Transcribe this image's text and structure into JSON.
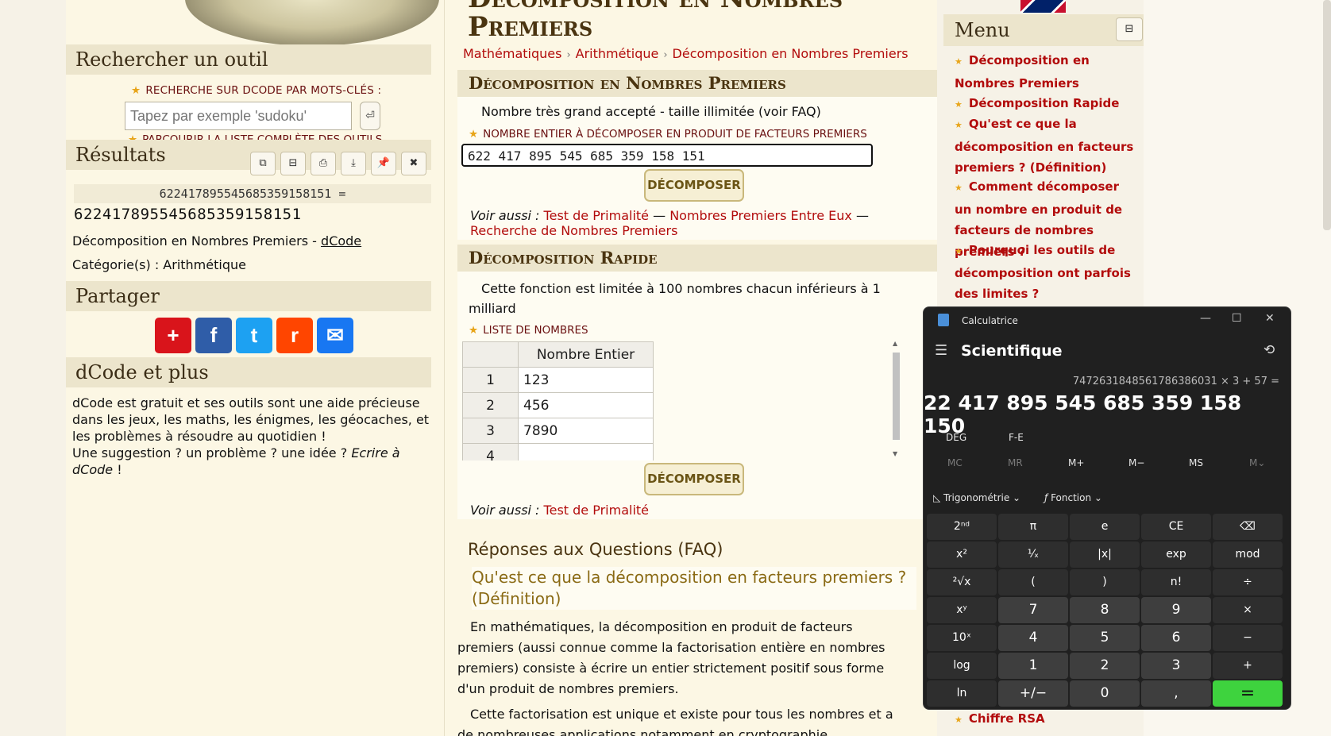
{
  "left": {
    "search_title": "Rechercher un outil",
    "search_label": "RECHERCHE SUR DCODE PAR MOTS-CLÉS :",
    "search_placeholder": "Tapez par exemple 'sudoku'",
    "browse_prefix": "PARCOURIR LA ",
    "browse_link": "LISTE COMPLÈTE DES OUTILS",
    "results_title": "Résultats",
    "result_expr": "62241789554568535915815​1 =",
    "result_value": "62241789554568535915815​1",
    "result_source_prefix": "Décomposition en Nombres Premiers - ",
    "result_source_link": "dCode",
    "result_category": "Catégorie(s) : Arithmétique",
    "share_title": "Partager",
    "more_title": "dCode et plus",
    "about_text": "dCode est gratuit et ses outils sont une aide précieuse dans les jeux, les maths, les énigmes, les géocaches, et les problèmes à résoudre au quotidien !",
    "about_line2": "Une suggestion ? un problème ? une idée ? ",
    "about_link": "Ecrire à dCode",
    "about_end": " !"
  },
  "main": {
    "title_line1": "Décomposition en Nombres",
    "title_line2": "Premiers",
    "crumbs": [
      "Mathématiques",
      "Arithmétique",
      "Décomposition en Nombres Premiers"
    ],
    "panel1_title": "Décomposition en Nombres Premiers",
    "panel1_note": "Nombre très grand accepté - taille illimitée (voir FAQ)",
    "panel1_label": "NOMBRE ENTIER À DÉCOMPOSER EN PRODUIT DE FACTEURS PREMIERS",
    "panel1_value": "622 417 895 545 685 359 158 151",
    "decompose": "DÉCOMPOSER",
    "voir_aussi": "Voir aussi :",
    "see_also1": [
      "Test de Primalité",
      "Nombres Premiers Entre Eux",
      "Recherche de Nombres Premiers"
    ],
    "panel2_title": "Décomposition Rapide",
    "panel2_note": "Cette fonction est limitée à 100 nombres chacun inférieurs à 1 milliard",
    "panel2_label": "LISTE DE NOMBRES",
    "table_header": "Nombre Entier",
    "table_rows": [
      {
        "idx": "1",
        "val": "123"
      },
      {
        "idx": "2",
        "val": "456"
      },
      {
        "idx": "3",
        "val": "7890"
      },
      {
        "idx": "4",
        "val": ""
      }
    ],
    "see_also2": "Test de Primalité",
    "faq_title": "Réponses aux Questions (FAQ)",
    "faq_q1": "Qu'est ce que la décomposition en facteurs premiers ? (Définition)",
    "faq_p1": "En mathématiques, la décomposition en produit de facteurs premiers (aussi connue comme la factorisation entière en nombres premiers) consiste à écrire un entier strictement positif sous forme d'un produit de nombres premiers.",
    "faq_p2": "Cette factorisation est unique et existe pour tous les nombres et a de nombreuses applications notamment en cryptographie."
  },
  "menu": {
    "title": "Menu",
    "items": [
      "Décomposition en Nombres Premiers",
      "Décomposition Rapide",
      "Qu'est ce que la décomposition en facteurs premiers ? (Définition)",
      "Comment décomposer un nombre en produit de facteurs de nombres premiers ?",
      "Pourquoi les outils de décomposition ont parfois des limites ?",
      "Chiffre RSA"
    ]
  },
  "calc": {
    "title": "Calculatrice",
    "mode": "Scientifique",
    "expression": "74726318485617863860​31 × 3 + 57 =",
    "display": "22 417 895 545 685 359 158 150",
    "deg": "DEG",
    "fe": "F-E",
    "memory": [
      "MC",
      "MR",
      "M+",
      "M−",
      "MS",
      "M⌄"
    ],
    "trig": "Trigonométrie",
    "func": "Fonction",
    "keys": [
      "2ⁿᵈ",
      "π",
      "e",
      "CE",
      "⌫",
      "x²",
      "¹⁄ₓ",
      "|x|",
      "exp",
      "mod",
      "²√x",
      "(",
      ")",
      "n!",
      "÷",
      "xʸ",
      "7",
      "8",
      "9",
      "×",
      "10ˣ",
      "4",
      "5",
      "6",
      "−",
      "log",
      "1",
      "2",
      "3",
      "+",
      "ln",
      "+/−",
      "0",
      ",",
      "="
    ]
  },
  "colors": {
    "accent_red": "#b20c0c",
    "equals_green": "#3ed33e",
    "calc_bg": "#202020"
  }
}
